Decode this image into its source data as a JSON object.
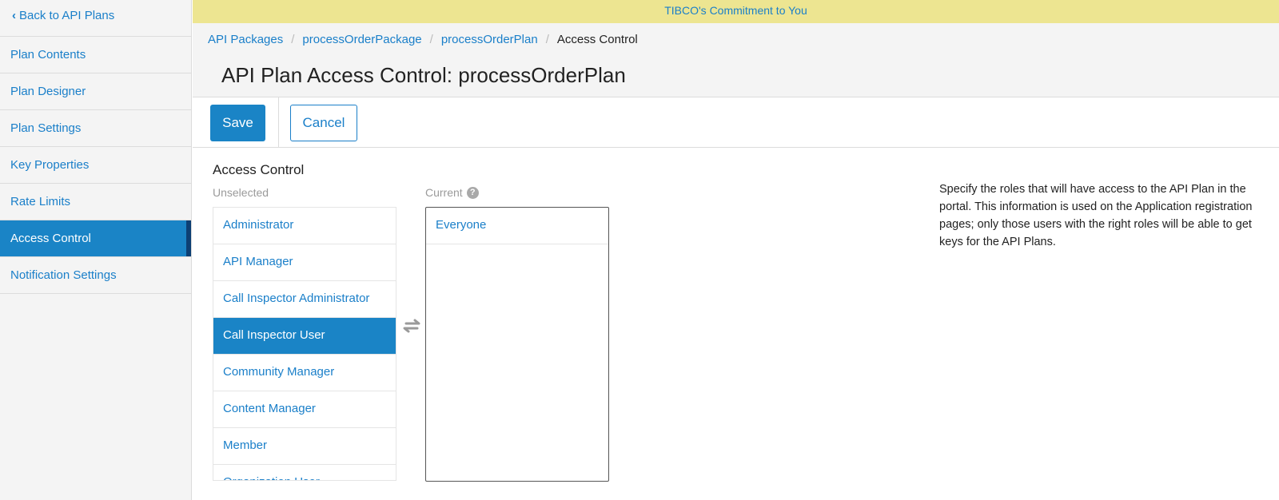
{
  "sidebar": {
    "back_label": "Back to API Plans",
    "items": [
      {
        "label": "Plan Contents",
        "active": false
      },
      {
        "label": "Plan Designer",
        "active": false
      },
      {
        "label": "Plan Settings",
        "active": false
      },
      {
        "label": "Key Properties",
        "active": false
      },
      {
        "label": "Rate Limits",
        "active": false
      },
      {
        "label": "Access Control",
        "active": true
      },
      {
        "label": "Notification Settings",
        "active": false
      }
    ]
  },
  "banner": {
    "text": "TIBCO's Commitment to You"
  },
  "breadcrumb": {
    "items": [
      "API Packages",
      "processOrderPackage",
      "processOrderPlan"
    ],
    "current": "Access Control"
  },
  "page": {
    "title": "API Plan Access Control: processOrderPlan"
  },
  "toolbar": {
    "save_label": "Save",
    "cancel_label": "Cancel"
  },
  "access_control": {
    "title": "Access Control",
    "unselected_label": "Unselected",
    "current_label": "Current",
    "unselected_items": [
      "Administrator",
      "API Manager",
      "Call Inspector Administrator",
      "Call Inspector User",
      "Community Manager",
      "Content Manager",
      "Member",
      "Organization User"
    ],
    "selected_index": 3,
    "current_items": [
      "Everyone"
    ],
    "description": "Specify the roles that will have access to the API Plan in the portal. This information is used on the Application registration pages; only those users with the right roles will be able to get keys for the API Plans."
  },
  "icons": {
    "back": "chevron-left-icon",
    "help": "question-circle-icon",
    "swap": "swap-arrows-icon"
  },
  "colors": {
    "accent": "#1a84c6",
    "link": "#1a7fc9",
    "banner": "#ede591",
    "active_marker": "#0d3f73"
  }
}
